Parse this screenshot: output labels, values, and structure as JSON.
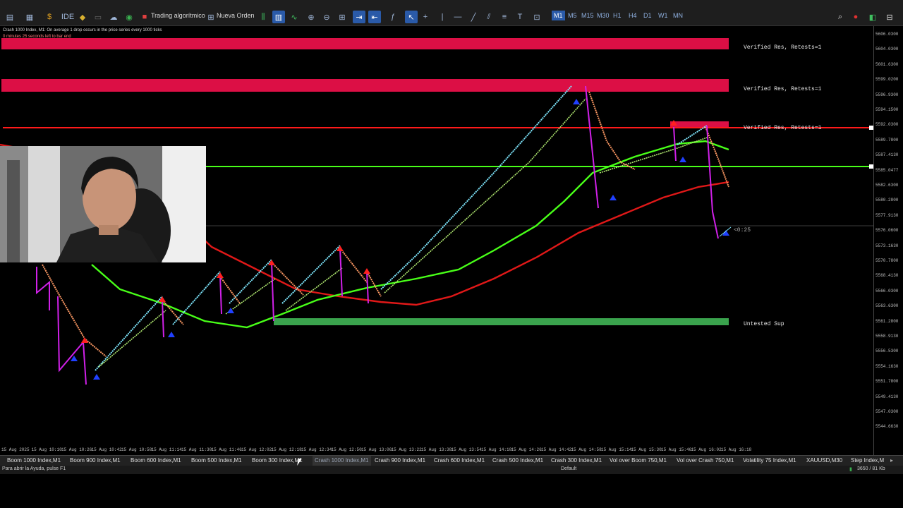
{
  "toolbar": {
    "algo_trading_label": "Trading algorítmico",
    "new_order_label": "Nueva Orden",
    "ide_label": "IDE",
    "timeframes": [
      "M1",
      "M5",
      "M15",
      "M30",
      "H1",
      "H4",
      "D1",
      "W1",
      "MN"
    ],
    "active_timeframe": "M1"
  },
  "chart": {
    "header_line1": "Crash 1000 Index, M1:  On average 1 drop occurs in the price series every 1000 ticks",
    "header_line2": "0 minutes 25 seconds left to bar end",
    "zones": [
      {
        "label": "Verified Res, Retests=1"
      },
      {
        "label": "Verified Res, Retests=1"
      },
      {
        "label": "Verified Res, Retests=1"
      },
      {
        "label": "Untested Sup"
      }
    ],
    "countdown": "<0:25",
    "price_labels": [
      "5606.0300",
      "5604.0300",
      "5601.6300",
      "5599.0200",
      "5596.9300",
      "5594.1500",
      "5592.0300",
      "5589.7800",
      "5587.4130",
      "5585.0477",
      "5582.6300",
      "5580.2800",
      "5577.9130",
      "5576.0600",
      "5573.1630",
      "5570.7800",
      "5568.4130",
      "5566.0300",
      "5563.6300",
      "5561.2800",
      "5558.9130",
      "5556.5300",
      "5554.1630",
      "5551.7800",
      "5549.4130",
      "5547.0300",
      "5544.6630"
    ],
    "time_labels": [
      "15 Aug 2025",
      "15 Aug 10:10",
      "15 Aug 10:26",
      "15 Aug 10:42",
      "15 Aug 10:58",
      "15 Aug 11:14",
      "15 Aug 11:30",
      "15 Aug 11:46",
      "15 Aug 12:02",
      "15 Aug 12:18",
      "15 Aug 12:34",
      "15 Aug 12:50",
      "15 Aug 13:06",
      "15 Aug 13:22",
      "15 Aug 13:38",
      "15 Aug 13:54",
      "15 Aug 14:10",
      "15 Aug 14:26",
      "15 Aug 14:42",
      "15 Aug 14:58",
      "15 Aug 15:14",
      "15 Aug 15:30",
      "15 Aug 15:46",
      "15 Aug 16:02",
      "15 Aug 16:18"
    ]
  },
  "symbol_tabs": [
    "Boom 1000 Index,M1",
    "Boom 900 Index,M1",
    "Boom 600 Index,M1",
    "Boom 500 Index,M1",
    "Boom 300 Index,M1",
    "Crash 1000 Index,M1",
    "Crash 900 Index,M1",
    "Crash 600 Index,M1",
    "Crash 500 Index,M1",
    "Crash 300 Index,M1",
    "Vol over Boom 750,M1",
    "Vol over Crash 750,M1",
    "Volatility 75 Index,M1",
    "XAUUSD,M30",
    "Step Index,M"
  ],
  "active_tab": "Crash 1000 Index,M1",
  "status": {
    "help_text": "Para abrir la Ayuda, pulse F1",
    "profile": "Default",
    "traffic": "3650 / 81 Kb"
  },
  "colors": {
    "resistance_zone": "#dc0f45",
    "support_zone": "#3aa34d",
    "ema_fast": "#48ff18",
    "ema_slow": "#e01818",
    "up_line": "#7fe8ff",
    "down_line": "#ff9a64",
    "spike": "#d020e8"
  }
}
